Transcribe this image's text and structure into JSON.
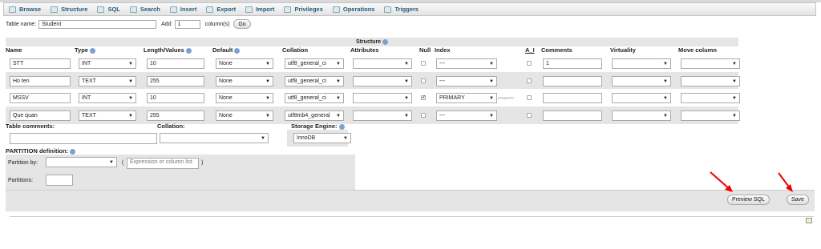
{
  "tabs": [
    {
      "label": "Browse",
      "icon": "browse-icon"
    },
    {
      "label": "Structure",
      "icon": "structure-icon"
    },
    {
      "label": "SQL",
      "icon": "sql-icon"
    },
    {
      "label": "Search",
      "icon": "search-icon"
    },
    {
      "label": "Insert",
      "icon": "insert-icon"
    },
    {
      "label": "Export",
      "icon": "export-icon"
    },
    {
      "label": "Import",
      "icon": "import-icon"
    },
    {
      "label": "Privileges",
      "icon": "privileges-icon"
    },
    {
      "label": "Operations",
      "icon": "operations-icon"
    },
    {
      "label": "Triggers",
      "icon": "triggers-icon"
    }
  ],
  "table_name_label": "Table name:",
  "table_name_value": "Student",
  "add_label": "Add",
  "add_value": "1",
  "columns_label": "column(s)",
  "go_label": "Go",
  "structure_label": "Structure",
  "headers": {
    "name": "Name",
    "type": "Type",
    "length": "Length/Values",
    "default": "Default",
    "collation": "Collation",
    "attributes": "Attributes",
    "null": "Null",
    "index": "Index",
    "ai": "A_I",
    "comments": "Comments",
    "virtuality": "Virtuality",
    "move": "Move column"
  },
  "rows": [
    {
      "name": "STT",
      "type": "INT",
      "length": "10",
      "default": "None",
      "collation": "utf8_general_ci",
      "null": false,
      "index": "---",
      "ai": false,
      "comment": "1"
    },
    {
      "name": "Ho ten",
      "type": "TEXT",
      "length": "255",
      "default": "None",
      "collation": "utf8_general_ci",
      "null": false,
      "index": "---",
      "ai": false,
      "comment": ""
    },
    {
      "name": "MSSV",
      "type": "INT",
      "length": "10",
      "default": "None",
      "collation": "utf8_general_ci",
      "null": true,
      "index": "PRIMARY",
      "index_note": "PRIMARY",
      "ai": false,
      "comment": ""
    },
    {
      "name": "Que quan",
      "type": "TEXT",
      "length": "255",
      "default": "None",
      "collation": "utf8mb4_general",
      "null": false,
      "index": "---",
      "ai": false,
      "comment": ""
    }
  ],
  "table_comments_label": "Table comments:",
  "collation_label": "Collation:",
  "storage_engine_label": "Storage Engine:",
  "storage_engine_value": "InnoDB",
  "partition_label": "PARTITION definition:",
  "partition_by_label": "Partition by:",
  "paren_open": "(",
  "expression_placeholder": "Expression or column list",
  "paren_close": ")",
  "partitions_label": "Partitions:",
  "preview_sql_label": "Preview SQL",
  "save_label": "Save",
  "colors": {
    "tab_text": "#235a81",
    "arrow": "#e00000",
    "row_alt": "#e5e5e5"
  }
}
